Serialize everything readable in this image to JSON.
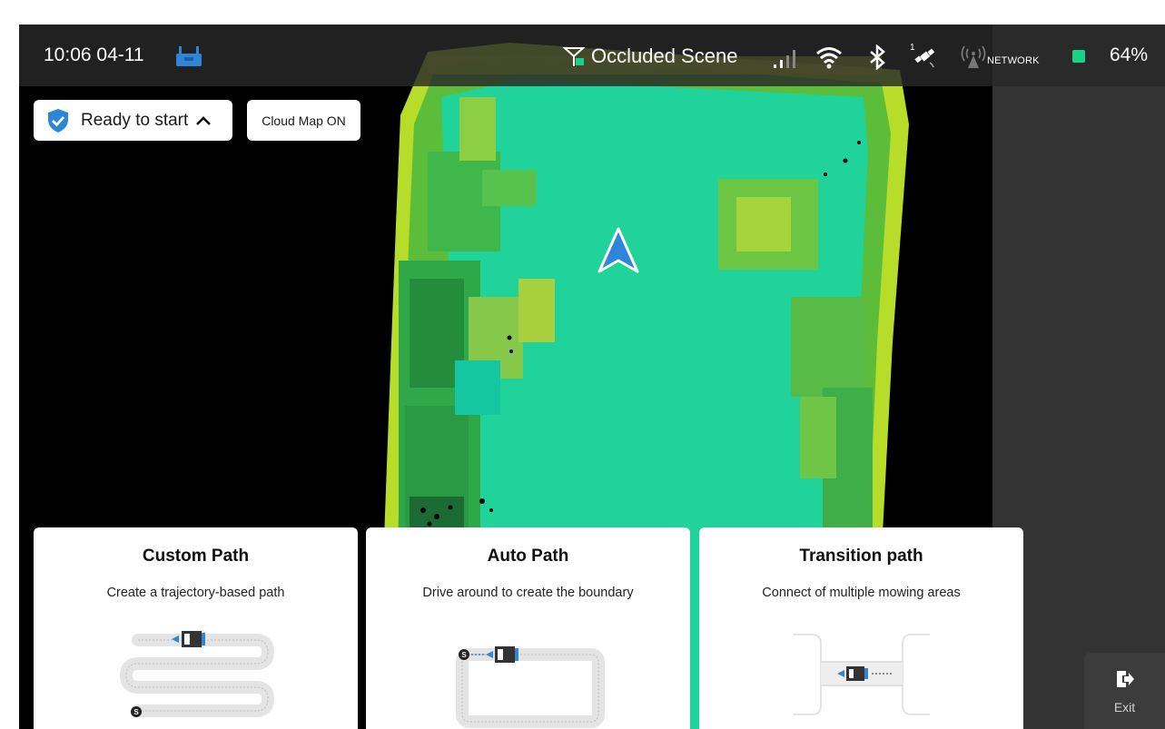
{
  "status_bar": {
    "time": "10:06 04-11",
    "scene": "Occluded Scene",
    "network": "NETWORK",
    "battery": "64%",
    "satellite_count": "1"
  },
  "chips": {
    "ready": "Ready to start",
    "cloud_map": "Cloud Map ON"
  },
  "cards": [
    {
      "title": "Custom Path",
      "description": "Create a trajectory-based path"
    },
    {
      "title": "Auto Path",
      "description": "Drive around to create the boundary"
    },
    {
      "title": "Transition path",
      "description": "Connect of multiple mowing areas"
    }
  ],
  "illustration_marker": "S",
  "exit": {
    "label": "Exit"
  },
  "colors": {
    "accent_blue": "#2f86d8",
    "map_green": "#1fd39a",
    "battery_green": "#19d28a",
    "status_bar": "#282828"
  },
  "icons": [
    "remote-controller-icon",
    "occluded-scene-icon",
    "signal-icon",
    "wifi-icon",
    "bluetooth-icon",
    "satellite-icon",
    "network-icon",
    "shield-check-icon",
    "chevron-up-icon",
    "mower-position-icon",
    "exit-icon"
  ]
}
